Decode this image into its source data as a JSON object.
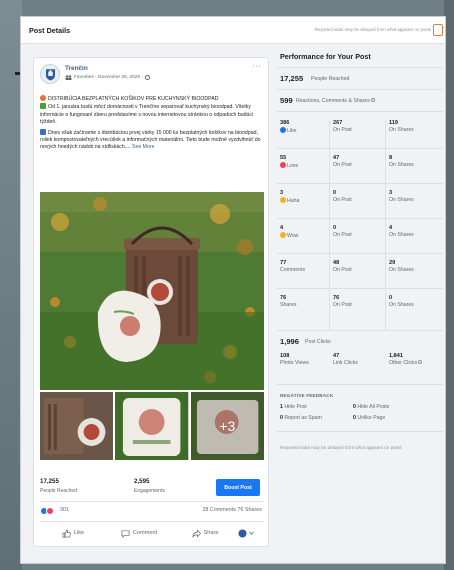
{
  "modal": {
    "title": "Post Details",
    "delay_note": "Reported stats may be delayed from what appears on posts"
  },
  "post": {
    "page_name": "Trenčín",
    "meta": "Favorites · November 25, 2020 ·",
    "more": "···",
    "text_1_a": "DISTRIBÚCIA BEZPLATNÝCH KOŠÍKOV PRE KUCHYNSKÝ BIOODPAD",
    "text_1_b": "Od 1. januára budú môcť domácnosti v Trenčíne separovať kuchynský bioodpad. Všetky informácie o fungovaní zberu predstavíme s novou internetovou stránkou o odpadoch budúci týždeň.",
    "text_2": "Dnes však začíname s distribúciou prvej várky 15 000 ks bezplatných košíkov na bioodpad, roliek kompostovateľných vrecúšok a informačných materiálmi. Tieto bude možné vyzdvihnúť do nových hnedých nádob na sídliskách....",
    "see_more": "See More",
    "more_photos": "+3",
    "people_reached_value": "17,255",
    "people_reached_label": "People Reached",
    "engagements_value": "2,595",
    "engagements_label": "Engagements",
    "boost_label": "Boost Post",
    "reaction_count": "301",
    "comments_shares": "28 Comments  76 Shares",
    "actions": {
      "like": "Like",
      "comment": "Comment",
      "share": "Share"
    },
    "reaction_colors": {
      "like": "#1877f2",
      "love": "#f33e58"
    }
  },
  "performance": {
    "title": "Performance for Your Post",
    "reached_value": "17,255",
    "reached_label": "People Reached",
    "reactions_value": "599",
    "reactions_label": "Reactions, Comments & Shares",
    "rows": [
      {
        "total": "386",
        "label": "Like",
        "on_post": "267",
        "on_shares": "119",
        "icon": "like-icon",
        "color": "#1877f2"
      },
      {
        "total": "55",
        "label": "Love",
        "on_post": "47",
        "on_shares": "8",
        "icon": "love-icon",
        "color": "#f33e58"
      },
      {
        "total": "3",
        "label": "Haha",
        "on_post": "0",
        "on_shares": "3",
        "icon": "haha-icon",
        "color": "#f7b125"
      },
      {
        "total": "4",
        "label": "Wow",
        "on_post": "0",
        "on_shares": "4",
        "icon": "wow-icon",
        "color": "#f7b125"
      },
      {
        "total": "77",
        "label": "Comments",
        "on_post": "48",
        "on_shares": "29",
        "icon": "",
        "color": ""
      },
      {
        "total": "76",
        "label": "Shares",
        "on_post": "76",
        "on_shares": "0",
        "icon": "",
        "color": ""
      }
    ],
    "on_post_label": "On Post",
    "on_shares_label": "On Shares",
    "post_clicks_value": "1,996",
    "post_clicks_label": "Post Clicks",
    "photo_views_value": "108",
    "photo_views_label": "Photo Views",
    "link_clicks_value": "47",
    "link_clicks_label": "Link Clicks",
    "other_clicks_value": "1,841",
    "other_clicks_label": "Other Clicks",
    "negative_title": "NEGATIVE FEEDBACK",
    "hide_post_value": "1",
    "hide_post_label": "Hide Post",
    "hide_all_value": "0",
    "hide_all_label": "Hide All Posts",
    "report_spam_value": "0",
    "report_spam_label": "Report as Spam",
    "unlike_value": "0",
    "unlike_label": "Unlike Page",
    "footnote": "Reported stats may be delayed from what appears on posts"
  }
}
